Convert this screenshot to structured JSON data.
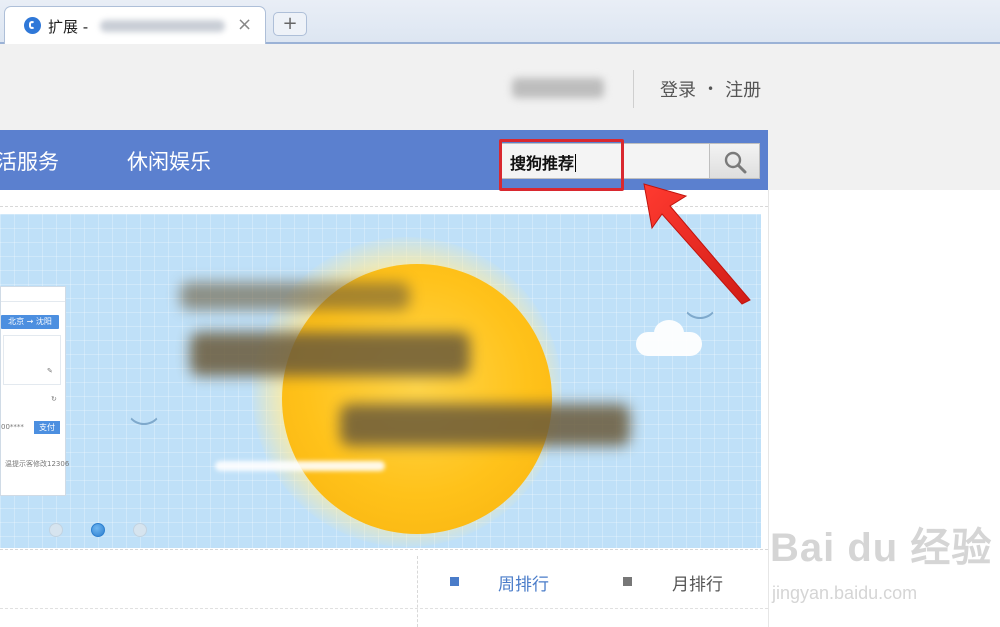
{
  "browser": {
    "tab_title": "扩展 -",
    "tab_close": "×",
    "new_tab": "+"
  },
  "header": {
    "login": "登录",
    "separator": "•",
    "register": "注册"
  },
  "nav": {
    "items": [
      "活服务",
      "休闲娱乐"
    ]
  },
  "search": {
    "value": "搜狗推荐"
  },
  "banner": {
    "mock_window": {
      "route": "北京 → 沈阳",
      "pay_button": "支付",
      "account_masked": "00****",
      "footer_text": "温提示客修改12306"
    },
    "carousel": {
      "dots": 3,
      "active_index": 1
    }
  },
  "ranking": {
    "tabs": [
      {
        "label": "周排行",
        "color": "#4a7cc9"
      },
      {
        "label": "月排行",
        "color": "#555555"
      }
    ]
  },
  "watermark": {
    "logo": "Bai du 经验",
    "url": "jingyan.baidu.com"
  },
  "colors": {
    "nav_blue": "#5b80cf",
    "highlight_red": "#d9282f"
  }
}
